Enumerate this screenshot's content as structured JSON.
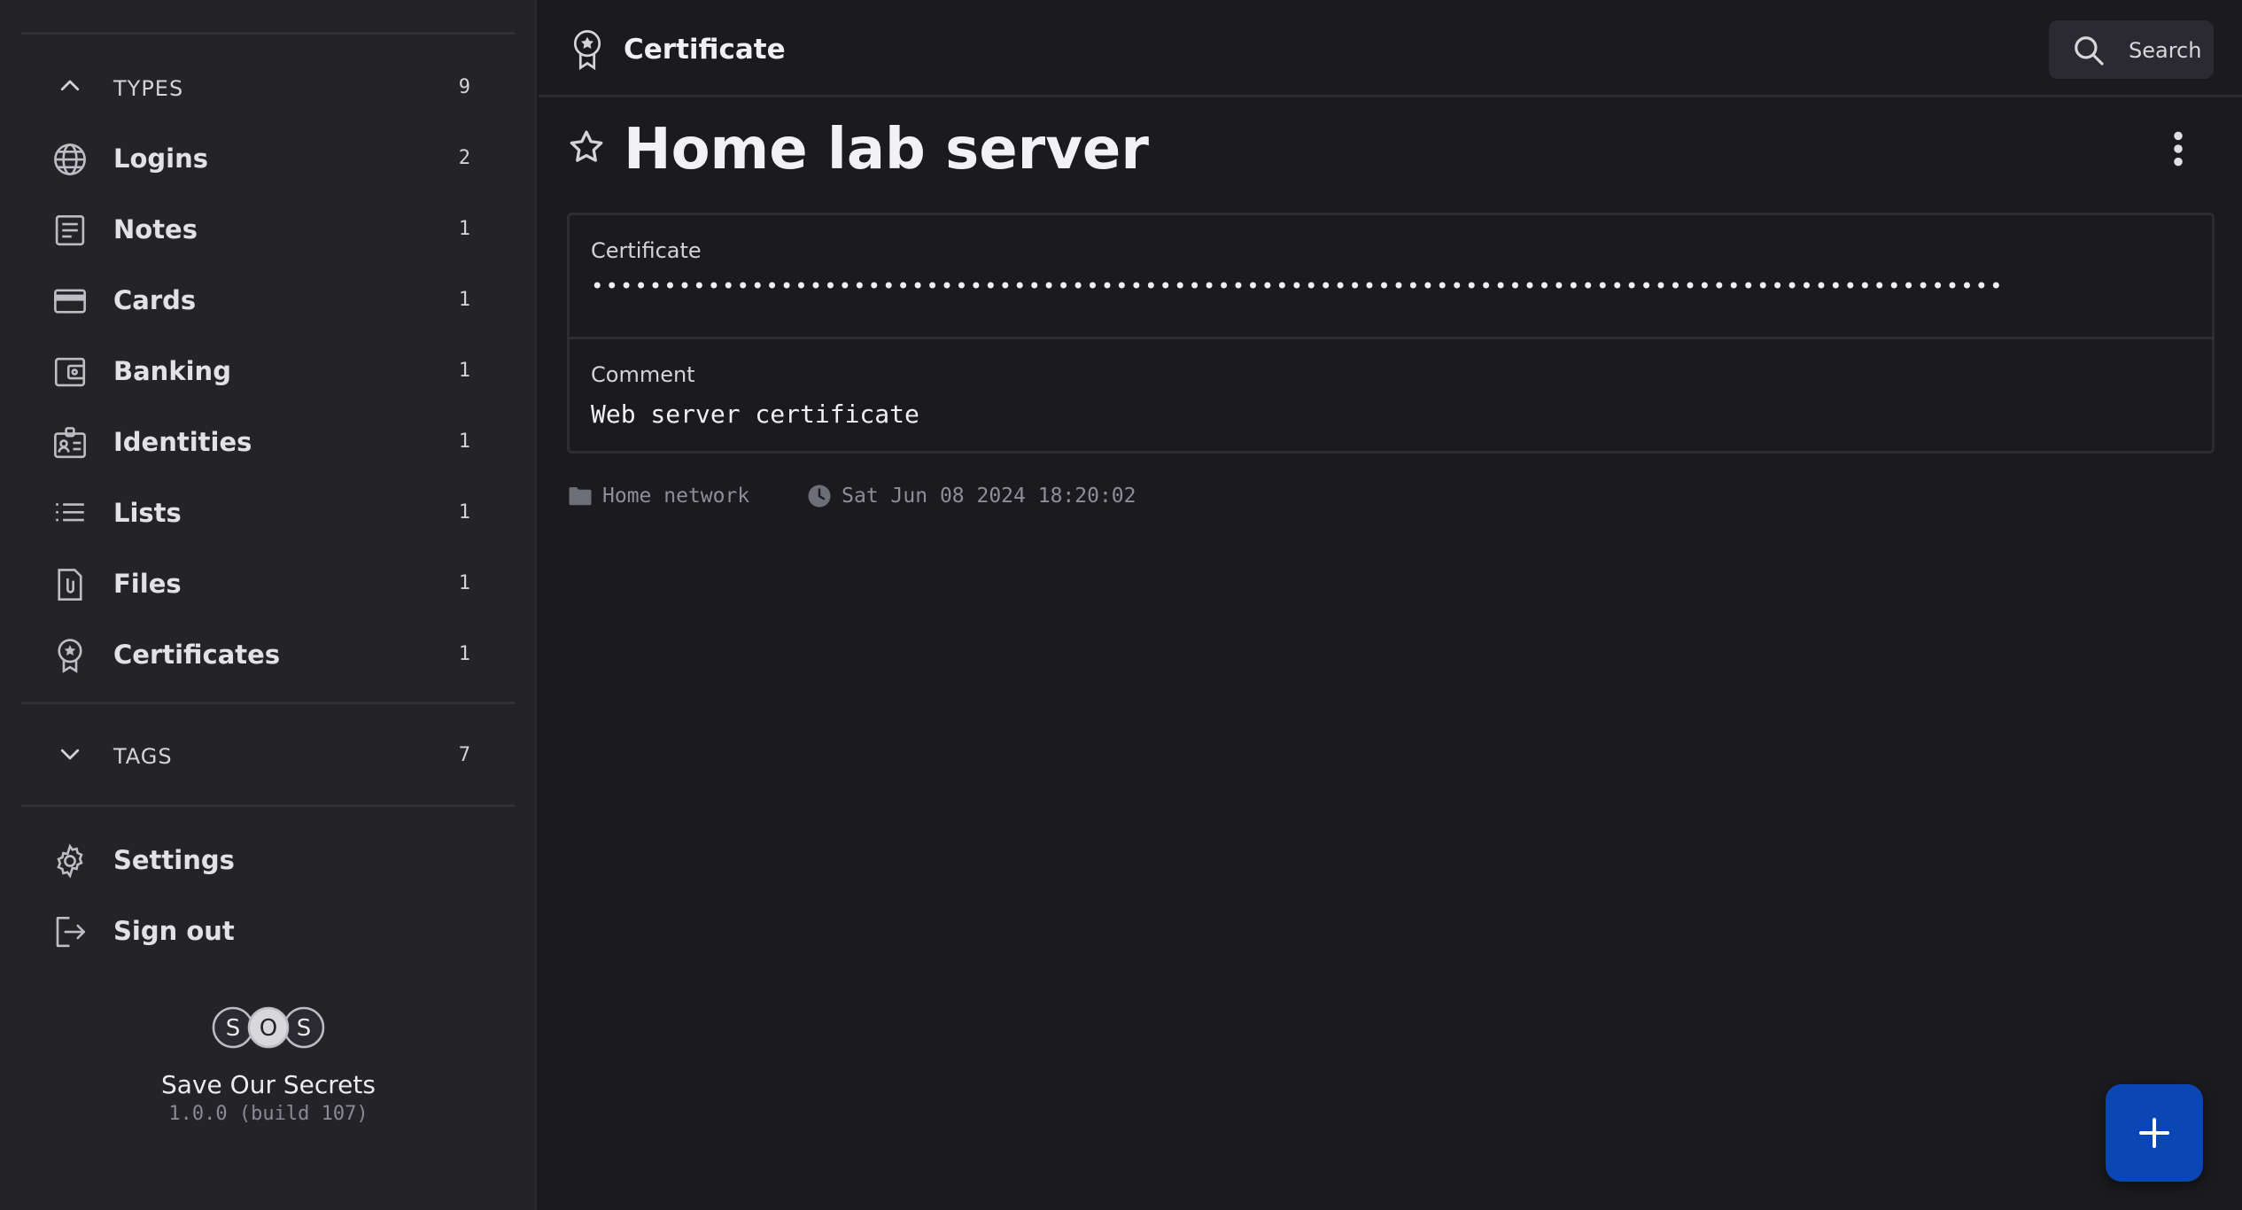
{
  "sidebar": {
    "types": {
      "label": "TYPES",
      "count": "9",
      "icon": "chevron-up-icon",
      "items": [
        {
          "label": "Logins",
          "count": "2",
          "icon": "globe-icon"
        },
        {
          "label": "Notes",
          "count": "1",
          "icon": "note-icon"
        },
        {
          "label": "Cards",
          "count": "1",
          "icon": "credit-card-icon"
        },
        {
          "label": "Banking",
          "count": "1",
          "icon": "wallet-icon"
        },
        {
          "label": "Identities",
          "count": "1",
          "icon": "id-badge-icon"
        },
        {
          "label": "Lists",
          "count": "1",
          "icon": "list-icon"
        },
        {
          "label": "Files",
          "count": "1",
          "icon": "file-attachment-icon"
        },
        {
          "label": "Certificates",
          "count": "1",
          "icon": "certificate-icon"
        }
      ]
    },
    "tags": {
      "label": "TAGS",
      "count": "7",
      "icon": "chevron-down-icon"
    },
    "actions": [
      {
        "label": "Settings",
        "icon": "gear-icon"
      },
      {
        "label": "Sign out",
        "icon": "sign-out-icon"
      }
    ],
    "brand": {
      "logo_letters": [
        "S",
        "O",
        "S"
      ],
      "name": "Save Our Secrets",
      "version": "1.0.0 (build 107)"
    }
  },
  "topbar": {
    "type_title": "Certificate",
    "search_label": "Search"
  },
  "item": {
    "title": "Home lab server",
    "favorite": false,
    "fields": [
      {
        "label": "Certificate",
        "value": "•••••••••••••••••••••••••••••••••••••••••••••••••••••••••••••••••••••••••••••••••••••••••••••••••"
      },
      {
        "label": "Comment",
        "value": "Web server certificate"
      }
    ],
    "folder": "Home network",
    "timestamp": "Sat Jun 08 2024 18:20:02"
  },
  "colors": {
    "sidebar_bg": "#232328",
    "main_bg": "#1b1b1f",
    "fab_bg": "#0b47b4",
    "muted_text": "#8e8e98"
  }
}
